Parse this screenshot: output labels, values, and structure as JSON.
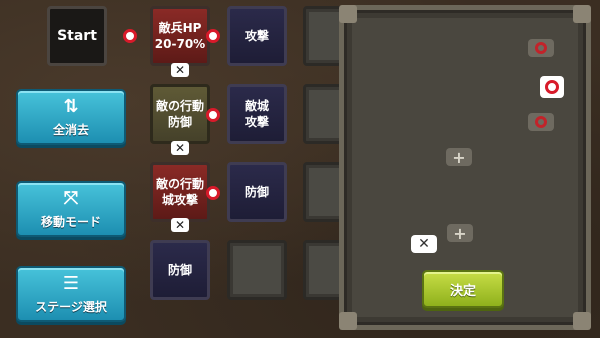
{
  "side_buttons": [
    {
      "label": "全消去",
      "icon": "⇅"
    },
    {
      "label": "移動モード",
      "icon": "⤧"
    },
    {
      "label": "ステージ選択",
      "icon": "☰"
    }
  ],
  "tiles": {
    "start": "Start",
    "r1c2": [
      "敵兵HP",
      "20-70%"
    ],
    "r1c3": "攻撃",
    "r2c2": [
      "敵の行動",
      "防御"
    ],
    "r2c3": [
      "敵城",
      "攻撃"
    ],
    "r3c2": [
      "敵の行動",
      "城攻撃"
    ],
    "r3c3": "防御",
    "r4c2": "防御"
  },
  "panel": {
    "confirm_label": "決定",
    "icons": [
      "connector-icon",
      "connector-icon-active",
      "connector-icon",
      "add-icon",
      "add-icon",
      "delete-icon"
    ]
  },
  "colors": {
    "side_button": "#1d8fb1",
    "confirm_button": "#a4c52a",
    "connector": "#d81a2a",
    "tile_red": "#6e211e",
    "tile_blue": "#24233f"
  }
}
